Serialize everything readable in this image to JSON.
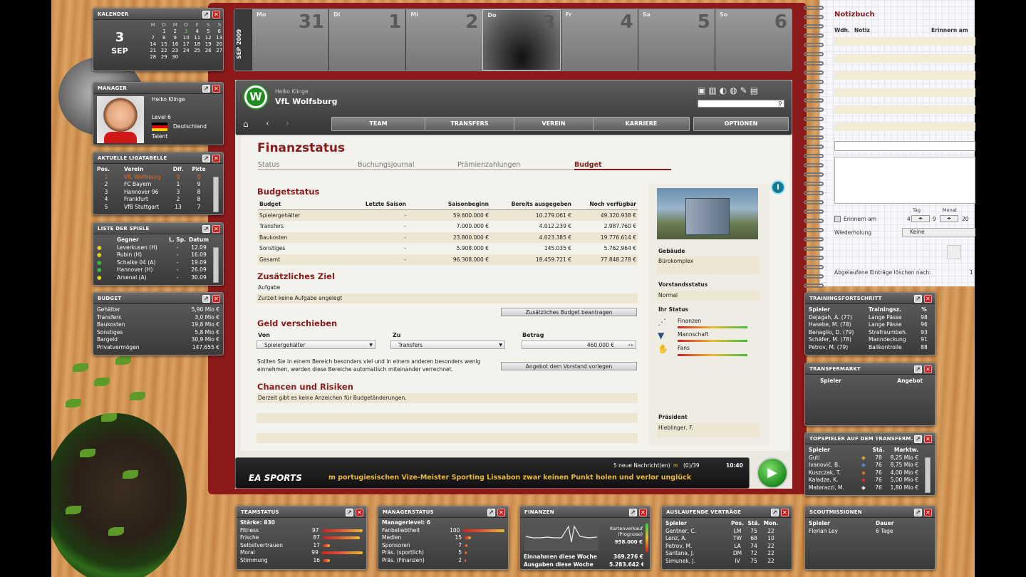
{
  "calendar": {
    "title": "KALENDER",
    "day": "3",
    "month": "SEP",
    "weekdays": [
      "M",
      "D",
      "M",
      "D",
      "F",
      "S",
      "S"
    ],
    "weeks": [
      [
        "",
        "",
        "1",
        "2",
        "3",
        "4",
        "5",
        "6"
      ],
      [
        "",
        "7",
        "8",
        "9",
        "10",
        "11",
        "12",
        "13"
      ],
      [
        "",
        "14",
        "15",
        "16",
        "17",
        "18",
        "19",
        "20"
      ],
      [
        "",
        "21",
        "22",
        "23",
        "24",
        "25",
        "26",
        "27"
      ],
      [
        "",
        "28",
        "29",
        "30",
        "",
        "",
        "",
        ""
      ]
    ]
  },
  "weekstrip": {
    "label": "SEP 2009",
    "days": [
      {
        "n": "Mo",
        "d": "31"
      },
      {
        "n": "Di",
        "d": "1"
      },
      {
        "n": "Mi",
        "d": "2"
      },
      {
        "n": "Do",
        "d": "3"
      },
      {
        "n": "Fr",
        "d": "4"
      },
      {
        "n": "Sa",
        "d": "5"
      },
      {
        "n": "So",
        "d": "6"
      }
    ]
  },
  "manager": {
    "title": "MANAGER",
    "name": "Heiko Klinge",
    "level": "Level 6",
    "country": "Deutschland",
    "trait": "Talent"
  },
  "liga": {
    "title": "AKTUELLE LIGATABELLE",
    "headers": [
      "Pos.",
      "Verein",
      "Dif.",
      "Pkte"
    ],
    "rows": [
      [
        "1",
        "VfL Wolfsburg",
        "9",
        "9"
      ],
      [
        "2",
        "FC Bayern",
        "1",
        "9"
      ],
      [
        "3",
        "Hannover 96",
        "3",
        "8"
      ],
      [
        "4",
        "Frankfurt",
        "2",
        "8"
      ],
      [
        "5",
        "VfB Stuttgart",
        "13",
        "7"
      ]
    ]
  },
  "spiele": {
    "title": "LISTE DER SPIELE",
    "headers": [
      "Gegner",
      "L. Sp.",
      "Datum"
    ],
    "rows": [
      [
        "Leverkusen (H)",
        "-",
        "12.09"
      ],
      [
        "Rubin (H)",
        "-",
        "16.09"
      ],
      [
        "Schalke 04 (A)",
        "-",
        "19.09"
      ],
      [
        "Hannover (H)",
        "-",
        "26.09"
      ],
      [
        "Arsenal (A)",
        "-",
        "30.09"
      ]
    ]
  },
  "budget_w": {
    "title": "BUDGET",
    "rows": [
      [
        "Gehälter",
        "5,90 Mio €"
      ],
      [
        "Transfers",
        "3,0 Mio €"
      ],
      [
        "Baukosten",
        "19,8 Mio €"
      ],
      [
        "Sonstiges",
        "5,8 Mio €"
      ],
      [
        "Bargeld",
        "30,9 Mio €"
      ],
      [
        "Privatvermögen",
        "147.655 €"
      ]
    ]
  },
  "club": {
    "manager": "Heiko Klinge",
    "name": "VfL Wolfsburg",
    "nav": [
      "TEAM",
      "TRANSFERS",
      "VEREIN",
      "KARRIERE",
      "OPTIONEN"
    ]
  },
  "main": {
    "title": "Finanzstatus",
    "tabs": [
      "Status",
      "Buchungsjournal",
      "Prämienzahlungen",
      "Budget"
    ],
    "budgetstatus": {
      "heading": "Budgetstatus",
      "headers": [
        "Budget",
        "Letzte Saison",
        "Saisonbeginn",
        "Bereits ausgegeben",
        "Noch verfügbar"
      ],
      "rows": [
        [
          "Spielergehälter",
          "-",
          "59.600.000 €",
          "10.279.061 €",
          "49.320.938 €"
        ],
        [
          "Transfers",
          "-",
          "7.000.000 €",
          "4.012.239 €",
          "2.987.760 €"
        ],
        [
          "Baukosten",
          "-",
          "23.800.000 €",
          "4.023.385 €",
          "19.776.614 €"
        ],
        [
          "Sonstiges",
          "-",
          "5.908.000 €",
          "145.035 €",
          "5.762.964 €"
        ],
        [
          "Gesamt",
          "-",
          "96.308.000 €",
          "18.459.721 €",
          "77.848.278 €"
        ]
      ]
    },
    "ziel": {
      "heading": "Zusätzliches Ziel",
      "label": "Aufgabe",
      "text": "Zurzeit keine Aufgabe angelegt",
      "button": "Zusätzliches Budget beantragen"
    },
    "geld": {
      "heading": "Geld verschieben",
      "von": "Von",
      "zu": "Zu",
      "betrag": "Betrag",
      "von_val": "Spielergehälter",
      "zu_val": "Transfers",
      "betrag_val": "460.000 €",
      "info": "Sollten Sie in einem Bereich besonders viel und in einem anderen besonders wenig einnehmen, werden diese Bereiche automatisch miteinander verrechnet.",
      "button": "Angebot dem Vorstand vorlegen"
    },
    "chancen": {
      "heading": "Chancen und Risiken",
      "text": "Derzeit gibt es keine Anzeichen für Budgetänderungen."
    }
  },
  "side": {
    "gebaeude": "Gebäude",
    "gebaeude_val": "Bürokomplex",
    "vorstand": "Vorstandsstatus",
    "vorstand_val": "Normal",
    "status": "Ihr Status",
    "items": [
      "Finanzen",
      "Mannschaft",
      "Fans"
    ],
    "praesident": "Präsident",
    "praesident_val": "Hieblinger, F."
  },
  "ticker": {
    "msgs": "5 neue Nachricht(en)",
    "mail": "(0)/39",
    "time": "10:40",
    "brand": "EA SPORTS",
    "text": "m portugiesischen Vize-Meister Sporting Lissabon zwar keinen Punkt holen und verlor unglücklich 0"
  },
  "notiz": {
    "title": "Notizbuch",
    "headers": [
      "Wdh.",
      "Notiz",
      "Erinnern am"
    ],
    "erinnern": "Erinnern am",
    "tag": "Tag",
    "monat": "Monat",
    "tag_val": "4",
    "monat_val": "9",
    "year": "20",
    "wdh": "Wiederholung",
    "wdh_val": "Keine",
    "abgel": "Abgelaufene Einträge löschen nach:",
    "abgel_val": "1"
  },
  "training": {
    "title": "TRAININGSFORTSCHRITT",
    "headers": [
      "Spieler",
      "Trainingsz.",
      "%"
    ],
    "rows": [
      [
        "Dejagah, A. (77)",
        "Lange Pässe",
        "98"
      ],
      [
        "Hasebe, M. (78)",
        "Lange Pässe",
        "96"
      ],
      [
        "Benaglio, D. (79)",
        "Strafraumbeh.",
        "93"
      ],
      [
        "Schäfer, M. (78)",
        "Manndeckung",
        "91"
      ],
      [
        "Petrov, M. (79)",
        "Ballkontrolle",
        "88"
      ]
    ]
  },
  "transfermarkt": {
    "title": "TRANSFERMARKT",
    "headers": [
      "Spieler",
      "Angebot"
    ]
  },
  "topspieler": {
    "title": "TOPSPIELER AUF DEM TRANSFERM.",
    "headers": [
      "Spieler",
      "Stä.",
      "Marktw."
    ],
    "rows": [
      [
        "Guti",
        "78",
        "8,25 Mio €"
      ],
      [
        "Ivanović, B.",
        "76",
        "8,75 Mio €"
      ],
      [
        "Kuszczak, T.",
        "76",
        "4,00 Mio €"
      ],
      [
        "Kaladze, K.",
        "76",
        "5,00 Mio €"
      ],
      [
        "Materazzi, M.",
        "76",
        "1,80 Mio €"
      ]
    ]
  },
  "teamstatus": {
    "title": "TEAMSTATUS",
    "staerke": "Stärke: 830",
    "rows": [
      [
        "Fitness",
        "97"
      ],
      [
        "Frische",
        "87"
      ],
      [
        "Selbstvertrauen",
        "17"
      ],
      [
        "Moral",
        "99"
      ],
      [
        "Stimmung",
        "16"
      ]
    ],
    "levels": [
      0.97,
      0.87,
      0.17,
      0.99,
      0.16
    ]
  },
  "managerstatus": {
    "title": "MANAGERSTATUS",
    "level": "Managerlevel: 6",
    "rows": [
      [
        "Fanbeliebtheit",
        "100"
      ],
      [
        "Medien",
        "15"
      ],
      [
        "Sponsoren",
        "7"
      ],
      [
        "Präs. (sportlich)",
        "5"
      ],
      [
        "Präs. (Finanzen)",
        "2"
      ]
    ],
    "levels": [
      1.0,
      0.15,
      0.07,
      0.05,
      0.02
    ]
  },
  "finanzen": {
    "title": "FINANZEN",
    "kv_label": "Kartenverkauf (Prognose)",
    "kv_val": "958.000 €",
    "ein": "Einnahmen diese Woche",
    "ein_val": "369.276 €",
    "aus": "Ausgaben diese Woche",
    "aus_val": "5.283.642 €"
  },
  "vertraege": {
    "title": "AUSLAUFENDE VERTRÄGE",
    "headers": [
      "Spieler",
      "Pos.",
      "Stä.",
      "Mon."
    ],
    "rows": [
      [
        "Gentner, C.",
        "LM",
        "75",
        "22"
      ],
      [
        "Lenz, A.",
        "TW",
        "68",
        "10"
      ],
      [
        "Petrov, M.",
        "LA",
        "74",
        "22"
      ],
      [
        "Santana, J.",
        "DM",
        "72",
        "22"
      ],
      [
        "Simunek, J.",
        "IV",
        "75",
        "22"
      ]
    ]
  },
  "scout": {
    "title": "SCOUTMISSIONEN",
    "headers": [
      "Spieler",
      "Dauer"
    ],
    "rows": [
      [
        "Florian Ley",
        "6 Tage"
      ]
    ]
  }
}
